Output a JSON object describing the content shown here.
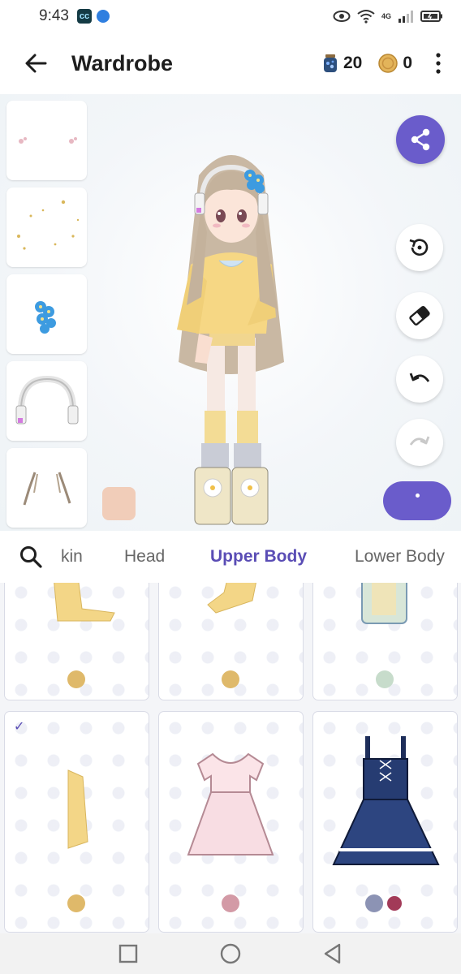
{
  "status_bar": {
    "time": "9:43",
    "app_badge": "cc",
    "network": "4G"
  },
  "app_bar": {
    "title": "Wardrobe",
    "jar_count": "20",
    "coin_count": "0"
  },
  "side_thumbnails": [
    {
      "item": "face-blush"
    },
    {
      "item": "sparkles"
    },
    {
      "item": "blue-flower-clip"
    },
    {
      "item": "headphones"
    },
    {
      "item": "hair-strands"
    }
  ],
  "skin_swatch_color": "#f1cdb9",
  "accent_color": "#6a5ccb",
  "tabs": [
    {
      "label": "kin",
      "active": false
    },
    {
      "label": "Head",
      "active": false
    },
    {
      "label": "Upper Body",
      "active": true
    },
    {
      "label": "Lower Body",
      "active": false
    }
  ],
  "items": [
    {
      "name": "yellow-sweater-sleeve",
      "selected": false,
      "colors": [
        "#dfb96a"
      ]
    },
    {
      "name": "yellow-arm-warmer",
      "selected": false,
      "colors": [
        "#dfb96a"
      ]
    },
    {
      "name": "blue-vest",
      "selected": false,
      "colors": [
        "#c7dccb"
      ]
    },
    {
      "name": "yellow-sweater-sleeve-2",
      "selected": true,
      "colors": [
        "#dfb96a"
      ]
    },
    {
      "name": "pink-dress",
      "selected": false,
      "colors": [
        "#d39aa6"
      ]
    },
    {
      "name": "navy-lolita-dress",
      "selected": false,
      "colors": [
        "#8c93b4",
        "#a23a58"
      ]
    }
  ]
}
